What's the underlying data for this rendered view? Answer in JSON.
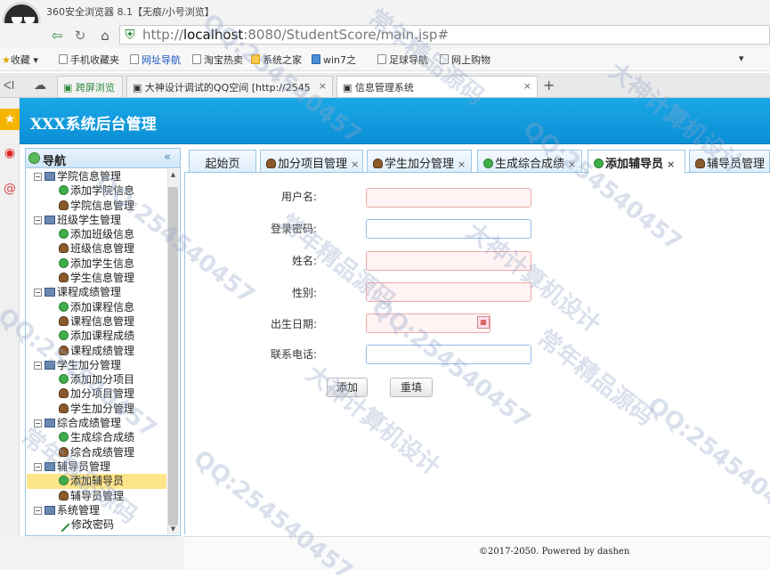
{
  "browser": {
    "window_title": "360安全浏览器 8.1【无痕/小号浏览】",
    "url_prefix": "http://",
    "url_host": "localhost",
    "url_rest": ":8080/StudentScore/main.jsp#",
    "bookmarks": [
      "收藏",
      "手机收藏夹",
      "网址导航",
      "淘宝热卖",
      "系统之家",
      "win7之",
      "足球导航",
      "网上购物"
    ],
    "tabs": [
      {
        "label": "跨屏浏览"
      },
      {
        "label": "大神设计调试的QQ空间 [http://2545"
      },
      {
        "label": "信息管理系统"
      }
    ],
    "new_tab": "+"
  },
  "app": {
    "title": "XXX系统后台管理"
  },
  "nav": {
    "title": "导航",
    "collapse": "«",
    "groups": [
      {
        "label": "学院信息管理",
        "items": [
          {
            "label": "添加学院信息",
            "icon": "add"
          },
          {
            "label": "学院信息管理",
            "icon": "user"
          }
        ]
      },
      {
        "label": "班级学生管理",
        "items": [
          {
            "label": "添加班级信息",
            "icon": "add"
          },
          {
            "label": "班级信息管理",
            "icon": "user"
          },
          {
            "label": "添加学生信息",
            "icon": "add"
          },
          {
            "label": "学生信息管理",
            "icon": "user"
          }
        ]
      },
      {
        "label": "课程成绩管理",
        "items": [
          {
            "label": "添加课程信息",
            "icon": "add"
          },
          {
            "label": "课程信息管理",
            "icon": "user"
          },
          {
            "label": "添加课程成绩",
            "icon": "add"
          },
          {
            "label": "课程成绩管理",
            "icon": "user"
          }
        ]
      },
      {
        "label": "学生加分管理",
        "items": [
          {
            "label": "添加加分项目",
            "icon": "add"
          },
          {
            "label": "加分项目管理",
            "icon": "user"
          },
          {
            "label": "学生加分管理",
            "icon": "user"
          }
        ]
      },
      {
        "label": "综合成绩管理",
        "items": [
          {
            "label": "生成综合成绩",
            "icon": "add"
          },
          {
            "label": "综合成绩管理",
            "icon": "user"
          }
        ]
      },
      {
        "label": "辅导员管理",
        "items": [
          {
            "label": "添加辅导员",
            "icon": "add",
            "selected": true
          },
          {
            "label": "辅导员管理",
            "icon": "user"
          }
        ]
      },
      {
        "label": "系统管理",
        "items": [
          {
            "label": "修改密码",
            "icon": "pen"
          }
        ]
      }
    ]
  },
  "content_tabs": [
    {
      "label": "起始页",
      "closable": false
    },
    {
      "label": "加分项目管理",
      "closable": true
    },
    {
      "label": "学生加分管理",
      "closable": true
    },
    {
      "label": "生成综合成绩",
      "closable": true
    },
    {
      "label": "添加辅导员",
      "closable": true,
      "active": true
    },
    {
      "label": "辅导员管理",
      "closable": false
    }
  ],
  "form": {
    "username_label": "用户名:",
    "password_label": "登录密码:",
    "name_label": "姓名:",
    "gender_label": "性别:",
    "birthday_label": "出生日期:",
    "phone_label": "联系电话:",
    "add_button": "添加",
    "reset_button": "重填"
  },
  "footer": {
    "text": "©2017-2050. Powered by dashen"
  },
  "watermark": {
    "qq": "QQ:254540457",
    "source": "常年精品源码",
    "design": "大神计算机设计"
  }
}
